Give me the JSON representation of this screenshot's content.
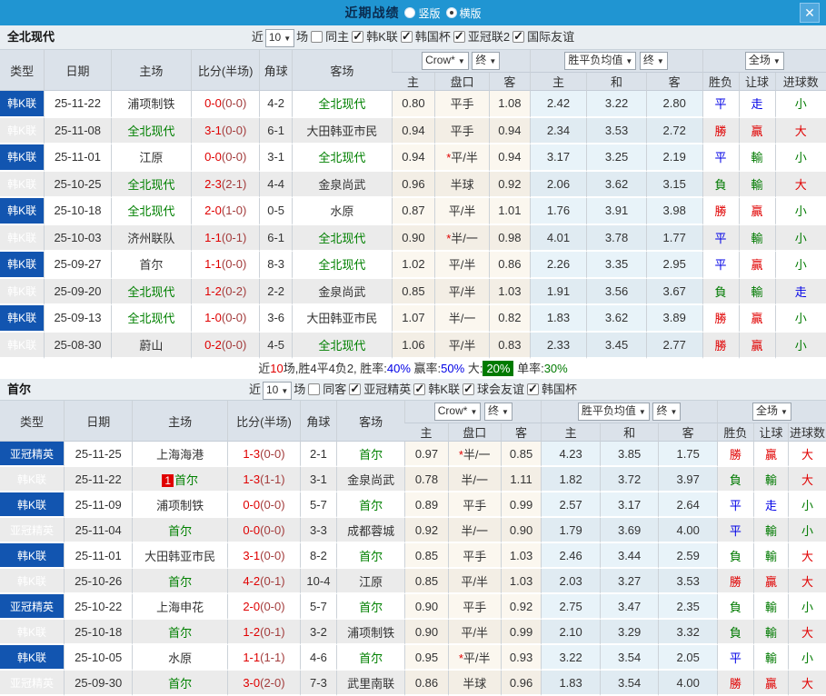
{
  "topbar": {
    "title": "近期战绩",
    "radio_vertical": "竖版",
    "radio_horizontal": "横版",
    "close": "✕"
  },
  "table_columns": {
    "left": [
      "类型",
      "日期",
      "主场",
      "比分(半场)",
      "角球",
      "客场"
    ],
    "crow_dd": "Crow*",
    "final_dd": "终",
    "crow_subs": [
      "主",
      "盘口",
      "客"
    ],
    "avg_dd": "胜平负均值",
    "final_dd2": "终",
    "avg_subs": [
      "主",
      "和",
      "客"
    ],
    "full_dd": "全场",
    "result_subs": [
      "胜负",
      "让球",
      "进球数"
    ]
  },
  "colors": {
    "topbar_blue": "#2095D2",
    "type_blue": "#1255B0",
    "win_red": "#E00000",
    "draw_blue": "#0000E6",
    "lose_green": "#007A00",
    "team_green": "#008000"
  },
  "sections": [
    {
      "team": "全北现代",
      "filter": {
        "near": "近",
        "count": "10",
        "games": "场",
        "same": "同主",
        "same_checked": false,
        "leagues": [
          "韩K联",
          "韩国杯",
          "亚冠联2",
          "国际友谊"
        ]
      },
      "rows": [
        {
          "type": "韩K联",
          "date": "25-11-22",
          "home": "浦项制铁",
          "home_green": false,
          "ft": "0-0",
          "ht": "(0-0)",
          "corner": "4-2",
          "away": "全北现代",
          "away_green": true,
          "crow_home": "0.80",
          "handicap": "平手",
          "crow_away": "1.08",
          "avg_home": "2.42",
          "avg_draw": "3.22",
          "avg_away": "2.80",
          "res_wdl": "平",
          "res_hc": "走",
          "res_goal": "小"
        },
        {
          "type": "韩K联",
          "date": "25-11-08",
          "home": "全北现代",
          "home_green": true,
          "ft": "3-1",
          "ht": "(0-0)",
          "corner": "6-1",
          "away": "大田韩亚市民",
          "away_green": false,
          "crow_home": "0.94",
          "handicap": "平手",
          "crow_away": "0.94",
          "avg_home": "2.34",
          "avg_draw": "3.53",
          "avg_away": "2.72",
          "res_wdl": "勝",
          "res_hc": "贏",
          "res_goal": "大"
        },
        {
          "type": "韩K联",
          "date": "25-11-01",
          "home": "江原",
          "home_green": false,
          "ft": "0-0",
          "ht": "(0-0)",
          "corner": "3-1",
          "away": "全北现代",
          "away_green": true,
          "crow_home": "0.94",
          "handicap": "*平/半",
          "crow_away": "0.94",
          "avg_home": "3.17",
          "avg_draw": "3.25",
          "avg_away": "2.19",
          "res_wdl": "平",
          "res_hc": "輸",
          "res_goal": "小"
        },
        {
          "type": "韩K联",
          "date": "25-10-25",
          "home": "全北现代",
          "home_green": true,
          "ft": "2-3",
          "ht": "(2-1)",
          "corner": "4-4",
          "away": "金泉尚武",
          "away_green": false,
          "crow_home": "0.96",
          "handicap": "半球",
          "crow_away": "0.92",
          "avg_home": "2.06",
          "avg_draw": "3.62",
          "avg_away": "3.15",
          "res_wdl": "負",
          "res_hc": "輸",
          "res_goal": "大"
        },
        {
          "type": "韩K联",
          "date": "25-10-18",
          "home": "全北现代",
          "home_green": true,
          "ft": "2-0",
          "ht": "(1-0)",
          "corner": "0-5",
          "away": "水原",
          "away_green": false,
          "crow_home": "0.87",
          "handicap": "平/半",
          "crow_away": "1.01",
          "avg_home": "1.76",
          "avg_draw": "3.91",
          "avg_away": "3.98",
          "res_wdl": "勝",
          "res_hc": "贏",
          "res_goal": "小"
        },
        {
          "type": "韩K联",
          "date": "25-10-03",
          "home": "济州联队",
          "home_green": false,
          "ft": "1-1",
          "ht": "(0-1)",
          "corner": "6-1",
          "away": "全北现代",
          "away_green": true,
          "crow_home": "0.90",
          "handicap": "*半/一",
          "crow_away": "0.98",
          "avg_home": "4.01",
          "avg_draw": "3.78",
          "avg_away": "1.77",
          "res_wdl": "平",
          "res_hc": "輸",
          "res_goal": "小"
        },
        {
          "type": "韩K联",
          "date": "25-09-27",
          "home": "首尔",
          "home_green": false,
          "ft": "1-1",
          "ht": "(0-0)",
          "corner": "8-3",
          "away": "全北现代",
          "away_green": true,
          "crow_home": "1.02",
          "handicap": "平/半",
          "crow_away": "0.86",
          "avg_home": "2.26",
          "avg_draw": "3.35",
          "avg_away": "2.95",
          "res_wdl": "平",
          "res_hc": "贏",
          "res_goal": "小"
        },
        {
          "type": "韩K联",
          "date": "25-09-20",
          "home": "全北现代",
          "home_green": true,
          "ft": "1-2",
          "ht": "(0-2)",
          "corner": "2-2",
          "away": "金泉尚武",
          "away_green": false,
          "crow_home": "0.85",
          "handicap": "平/半",
          "crow_away": "1.03",
          "avg_home": "1.91",
          "avg_draw": "3.56",
          "avg_away": "3.67",
          "res_wdl": "負",
          "res_hc": "輸",
          "res_goal": "走"
        },
        {
          "type": "韩K联",
          "date": "25-09-13",
          "home": "全北现代",
          "home_green": true,
          "ft": "1-0",
          "ht": "(0-0)",
          "corner": "3-6",
          "away": "大田韩亚市民",
          "away_green": false,
          "crow_home": "1.07",
          "handicap": "半/一",
          "crow_away": "0.82",
          "avg_home": "1.83",
          "avg_draw": "3.62",
          "avg_away": "3.89",
          "res_wdl": "勝",
          "res_hc": "贏",
          "res_goal": "小"
        },
        {
          "type": "韩K联",
          "date": "25-08-30",
          "home": "蔚山",
          "home_green": false,
          "ft": "0-2",
          "ht": "(0-0)",
          "corner": "4-5",
          "away": "全北现代",
          "away_green": true,
          "crow_home": "1.06",
          "handicap": "平/半",
          "crow_away": "0.83",
          "avg_home": "2.33",
          "avg_draw": "3.45",
          "avg_away": "2.77",
          "res_wdl": "勝",
          "res_hc": "贏",
          "res_goal": "小"
        }
      ],
      "summary": [
        {
          "t": "近",
          "c": "k"
        },
        {
          "t": "10",
          "c": "r"
        },
        {
          "t": "场,胜4平4负2, ",
          "c": "k"
        },
        {
          "t": "胜率:",
          "c": "k"
        },
        {
          "t": "40%",
          "c": "b"
        },
        {
          "t": " 赢率:",
          "c": "k"
        },
        {
          "t": "50%",
          "c": "b"
        },
        {
          "t": " 大:",
          "c": "k"
        },
        {
          "t": "20%",
          "c": "wg"
        },
        {
          "t": " 单率:",
          "c": "k"
        },
        {
          "t": "30%",
          "c": "g"
        }
      ]
    },
    {
      "team": "首尔",
      "filter": {
        "near": "近",
        "count": "10",
        "games": "场",
        "same": "同客",
        "same_checked": false,
        "leagues": [
          "亚冠精英",
          "韩K联",
          "球会友谊",
          "韩国杯"
        ]
      },
      "rows": [
        {
          "type": "亚冠精英",
          "date": "25-11-25",
          "home": "上海海港",
          "home_green": false,
          "ft": "1-3",
          "ht": "(0-0)",
          "corner": "2-1",
          "away": "首尔",
          "away_green": true,
          "crow_home": "0.97",
          "handicap": "*半/一",
          "crow_away": "0.85",
          "avg_home": "4.23",
          "avg_draw": "3.85",
          "avg_away": "1.75",
          "res_wdl": "勝",
          "res_hc": "贏",
          "res_goal": "大"
        },
        {
          "type": "韩K联",
          "date": "25-11-22",
          "home": "首尔",
          "home_green": true,
          "badge": "1",
          "ft": "1-3",
          "ht": "(1-1)",
          "corner": "3-1",
          "away": "金泉尚武",
          "away_green": false,
          "crow_home": "0.78",
          "handicap": "半/一",
          "crow_away": "1.11",
          "avg_home": "1.82",
          "avg_draw": "3.72",
          "avg_away": "3.97",
          "res_wdl": "負",
          "res_hc": "輸",
          "res_goal": "大"
        },
        {
          "type": "韩K联",
          "date": "25-11-09",
          "home": "浦项制铁",
          "home_green": false,
          "ft": "0-0",
          "ht": "(0-0)",
          "corner": "5-7",
          "away": "首尔",
          "away_green": true,
          "crow_home": "0.89",
          "handicap": "平手",
          "crow_away": "0.99",
          "avg_home": "2.57",
          "avg_draw": "3.17",
          "avg_away": "2.64",
          "res_wdl": "平",
          "res_hc": "走",
          "res_goal": "小"
        },
        {
          "type": "亚冠精英",
          "date": "25-11-04",
          "home": "首尔",
          "home_green": true,
          "ft": "0-0",
          "ht": "(0-0)",
          "corner": "3-3",
          "away": "成都蓉城",
          "away_green": false,
          "crow_home": "0.92",
          "handicap": "半/一",
          "crow_away": "0.90",
          "avg_home": "1.79",
          "avg_draw": "3.69",
          "avg_away": "4.00",
          "res_wdl": "平",
          "res_hc": "輸",
          "res_goal": "小"
        },
        {
          "type": "韩K联",
          "date": "25-11-01",
          "home": "大田韩亚市民",
          "home_green": false,
          "ft": "3-1",
          "ht": "(0-0)",
          "corner": "8-2",
          "away": "首尔",
          "away_green": true,
          "crow_home": "0.85",
          "handicap": "平手",
          "crow_away": "1.03",
          "avg_home": "2.46",
          "avg_draw": "3.44",
          "avg_away": "2.59",
          "res_wdl": "負",
          "res_hc": "輸",
          "res_goal": "大"
        },
        {
          "type": "韩K联",
          "date": "25-10-26",
          "home": "首尔",
          "home_green": true,
          "ft": "4-2",
          "ht": "(0-1)",
          "corner": "10-4",
          "away": "江原",
          "away_green": false,
          "crow_home": "0.85",
          "handicap": "平/半",
          "crow_away": "1.03",
          "avg_home": "2.03",
          "avg_draw": "3.27",
          "avg_away": "3.53",
          "res_wdl": "勝",
          "res_hc": "贏",
          "res_goal": "大"
        },
        {
          "type": "亚冠精英",
          "date": "25-10-22",
          "home": "上海申花",
          "home_green": false,
          "ft": "2-0",
          "ht": "(0-0)",
          "corner": "5-7",
          "away": "首尔",
          "away_green": true,
          "crow_home": "0.90",
          "handicap": "平手",
          "crow_away": "0.92",
          "avg_home": "2.75",
          "avg_draw": "3.47",
          "avg_away": "2.35",
          "res_wdl": "負",
          "res_hc": "輸",
          "res_goal": "小"
        },
        {
          "type": "韩K联",
          "date": "25-10-18",
          "home": "首尔",
          "home_green": true,
          "ft": "1-2",
          "ht": "(0-1)",
          "corner": "3-2",
          "away": "浦项制铁",
          "away_green": false,
          "crow_home": "0.90",
          "handicap": "平/半",
          "crow_away": "0.99",
          "avg_home": "2.10",
          "avg_draw": "3.29",
          "avg_away": "3.32",
          "res_wdl": "負",
          "res_hc": "輸",
          "res_goal": "大"
        },
        {
          "type": "韩K联",
          "date": "25-10-05",
          "home": "水原",
          "home_green": false,
          "ft": "1-1",
          "ht": "(1-1)",
          "corner": "4-6",
          "away": "首尔",
          "away_green": true,
          "crow_home": "0.95",
          "handicap": "*平/半",
          "crow_away": "0.93",
          "avg_home": "3.22",
          "avg_draw": "3.54",
          "avg_away": "2.05",
          "res_wdl": "平",
          "res_hc": "輸",
          "res_goal": "小"
        },
        {
          "type": "亚冠精英",
          "date": "25-09-30",
          "home": "首尔",
          "home_green": true,
          "ft": "3-0",
          "ht": "(2-0)",
          "corner": "7-3",
          "away": "武里南联",
          "away_green": false,
          "crow_home": "0.86",
          "handicap": "半球",
          "crow_away": "0.96",
          "avg_home": "1.83",
          "avg_draw": "3.54",
          "avg_away": "4.00",
          "res_wdl": "勝",
          "res_hc": "贏",
          "res_goal": "大"
        }
      ]
    }
  ]
}
